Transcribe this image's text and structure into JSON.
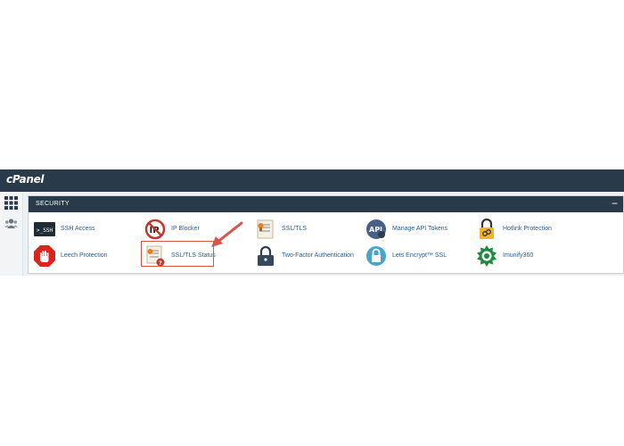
{
  "header": {
    "logo_text": "cPanel"
  },
  "sidebar": {
    "items": [
      {
        "icon": "grid-icon"
      },
      {
        "icon": "users-icon"
      }
    ]
  },
  "section": {
    "title": "SECURITY",
    "collapse_symbol": "−",
    "items": [
      {
        "label": "SSH Access",
        "icon": "ssh-terminal-icon"
      },
      {
        "label": "IP Blocker",
        "icon": "ip-blocker-icon"
      },
      {
        "label": "SSL/TLS",
        "icon": "ssl-certificate-icon"
      },
      {
        "label": "Manage API Tokens",
        "icon": "api-token-icon"
      },
      {
        "label": "Hotlink Protection",
        "icon": "padlock-chain-icon"
      },
      {
        "label": "Leech Protection",
        "icon": "stop-hand-icon"
      },
      {
        "label": "SSL/TLS Status",
        "icon": "ssl-status-icon"
      },
      {
        "label": "Two-Factor Authentication",
        "icon": "padlock-icon"
      },
      {
        "label": "Lets Encrypt™ SSL",
        "icon": "lets-encrypt-icon"
      },
      {
        "label": "Imunify360",
        "icon": "imunify-icon"
      }
    ]
  },
  "colors": {
    "header": "#293a4a",
    "link": "#2a5d8c",
    "highlight": "#d9534f"
  }
}
